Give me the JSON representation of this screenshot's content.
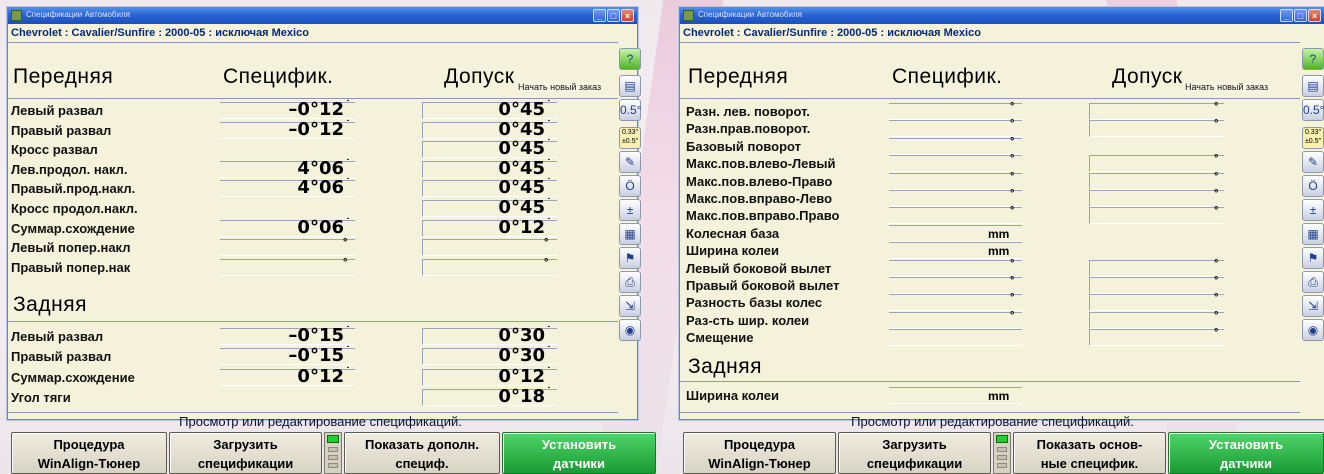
{
  "left": {
    "title": "Спецификации Автомобиля",
    "vehicle": "Chevrolet : Cavalier/Sunfire : 2000-05 : исключая Mexico",
    "section_front": "Передняя",
    "col_spec": "Специфик.",
    "col_tol": "Допуск",
    "tooltip": "Начать новый заказ",
    "front_rows": [
      {
        "label": "Левый развал",
        "spec": "–0°12",
        "tol": "0°45"
      },
      {
        "label": "Правый развал",
        "spec": "–0°12",
        "tol": "0°45"
      },
      {
        "label": "Кросс развал",
        "spec": "",
        "tol": "0°45"
      },
      {
        "label": "Лев.продол. накл.",
        "spec": "4°06",
        "tol": "0°45"
      },
      {
        "label": "Правый.прод.накл.",
        "spec": "4°06",
        "tol": "0°45"
      },
      {
        "label": "Кросс продол.накл.",
        "spec": "",
        "tol": "0°45"
      },
      {
        "label": "Суммар.схождение",
        "spec": "0°06",
        "tol": "0°12"
      },
      {
        "label": "Левый попер.накл",
        "spec": "°",
        "tol": "°"
      },
      {
        "label": "Правый попер.нак",
        "spec": "°",
        "tol": "°"
      }
    ],
    "section_rear": "Задняя",
    "rear_rows": [
      {
        "label": "Левый развал",
        "spec": "–0°15",
        "tol": "0°30"
      },
      {
        "label": "Правый развал",
        "spec": "–0°15",
        "tol": "0°30"
      },
      {
        "label": "Суммар.схождение",
        "spec": "0°12",
        "tol": "0°12"
      },
      {
        "label": "Угол тяги",
        "spec": "",
        "tol": "0°18"
      }
    ],
    "status": "Просмотр или редактирование спецификаций.",
    "buttons": [
      {
        "l1": "Процедура",
        "l2": "WinAlign-Тюнер"
      },
      {
        "l1": "Загрузить",
        "l2": "спецификации"
      },
      {
        "l1": "Показать дополн.",
        "l2": "специф."
      },
      {
        "l1": "Установить",
        "l2": "датчики"
      }
    ]
  },
  "right": {
    "title": "Спецификации Автомобиля",
    "vehicle": "Chevrolet : Cavalier/Sunfire : 2000-05 : исключая Mexico",
    "section_front": "Передняя",
    "col_spec": "Специфик.",
    "col_tol": "Допуск",
    "tooltip": "Начать новый заказ",
    "front_rows": [
      {
        "label": "Разн. лев. поворот.",
        "spec": "°",
        "tol": "°"
      },
      {
        "label": "Разн.прав.поворот.",
        "spec": "°",
        "tol": "°"
      },
      {
        "label": "Базовый поворот",
        "spec": "°",
        "tol": ""
      },
      {
        "label": "Макс.пов.влево-Левый",
        "spec": "°",
        "tol": "°"
      },
      {
        "label": "Макс.пов.влево-Право",
        "spec": "°",
        "tol": "°"
      },
      {
        "label": "Макс.пов.вправо-Лево",
        "spec": "°",
        "tol": "°"
      },
      {
        "label": "Макс.пов.вправо.Право",
        "spec": "°",
        "tol": "°"
      },
      {
        "label": "Колесная база",
        "spec": "mm",
        "tol": ""
      },
      {
        "label": "Ширина колеи",
        "spec": "mm",
        "tol": ""
      },
      {
        "label": "Левый боковой вылет",
        "spec": "°",
        "tol": "°"
      },
      {
        "label": "Правый боковой вылет",
        "spec": "°",
        "tol": "°"
      },
      {
        "label": "Разность базы колес",
        "spec": "°",
        "tol": "°"
      },
      {
        "label": "Раз-сть шир. колеи",
        "spec": "°",
        "tol": "°"
      },
      {
        "label": "Смещение",
        "spec": "",
        "tol": "°"
      }
    ],
    "section_rear": "Задняя",
    "rear_rows": [
      {
        "label": "Ширина колеи",
        "spec": "mm",
        "tol": ""
      }
    ],
    "status": "Просмотр или редактирование спецификаций.",
    "buttons": [
      {
        "l1": "Процедура",
        "l2": "WinAlign-Тюнер"
      },
      {
        "l1": "Загрузить",
        "l2": "спецификации"
      },
      {
        "l1": "Показать основ-",
        "l2": "ные специфик."
      },
      {
        "l1": "Установить",
        "l2": "датчики"
      }
    ]
  },
  "toolbar_icons": [
    {
      "name": "help-icon",
      "glyph": "?"
    },
    {
      "name": "notes-icon",
      "glyph": "▤"
    },
    {
      "name": "zoom-degrees-icon",
      "glyph": "0.5°"
    },
    {
      "name": "units-toggle-icon",
      "glyph": "0.33″ ±0.5″"
    },
    {
      "name": "tool-icon",
      "glyph": "✎"
    },
    {
      "name": "timer-icon",
      "glyph": "Ö"
    },
    {
      "name": "specs-color-icon",
      "glyph": "±"
    },
    {
      "name": "calculator-icon",
      "glyph": "▦"
    },
    {
      "name": "flag-icon",
      "glyph": "⚑"
    },
    {
      "name": "printer-icon",
      "glyph": "⎙"
    },
    {
      "name": "export-icon",
      "glyph": "⇲"
    },
    {
      "name": "globe-icon",
      "glyph": "◉"
    }
  ],
  "colors": {
    "window_bg": "#f4f2da",
    "title_blue": "#2a62d2",
    "vehicle_text": "#062a7a",
    "install_green": "#1b9a33"
  }
}
